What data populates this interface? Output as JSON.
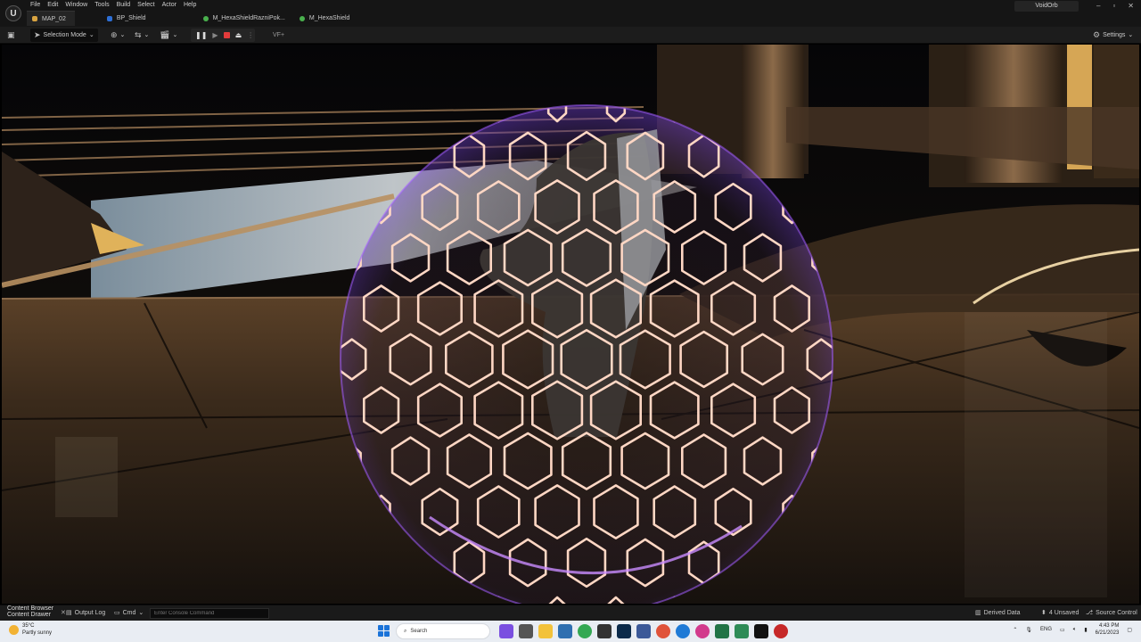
{
  "menu": {
    "items": [
      "File",
      "Edit",
      "Window",
      "Tools",
      "Build",
      "Select",
      "Actor",
      "Help"
    ]
  },
  "tabs": [
    {
      "label": "MAP_02",
      "color": "#d9a441",
      "active": true
    },
    {
      "label": "BP_Shield",
      "color": "#2d6fd6",
      "active": false
    },
    {
      "label": "M_HexaShieldRazniPok...",
      "color": "#49b04d",
      "active": false
    },
    {
      "label": "M_HexaShield",
      "color": "#49b04d",
      "active": false
    }
  ],
  "project_name": "VoidOrb",
  "toolbar": {
    "selection_mode": "Selection Mode",
    "extra_label": "VF+",
    "settings": "Settings"
  },
  "statusbar": {
    "content_browser_top": "Content Browser",
    "content_drawer": "Content Drawer",
    "output_log": "Output Log",
    "cmd": "Cmd",
    "console_placeholder": "Enter Console Command",
    "derived_data": "Derived Data",
    "unsaved": "4 Unsaved",
    "source_control": "Source Control"
  },
  "taskbar": {
    "temperature": "35°C",
    "weather": "Partly sunny",
    "search": "Search",
    "lang": "ENG",
    "time": "4:43 PM",
    "date": "6/21/2023"
  },
  "colors": {
    "hex_line": "#ffd7c4",
    "hex_glow": "#e87f5a",
    "rim": "#a25cff",
    "accent_play": "#e23b3b"
  }
}
